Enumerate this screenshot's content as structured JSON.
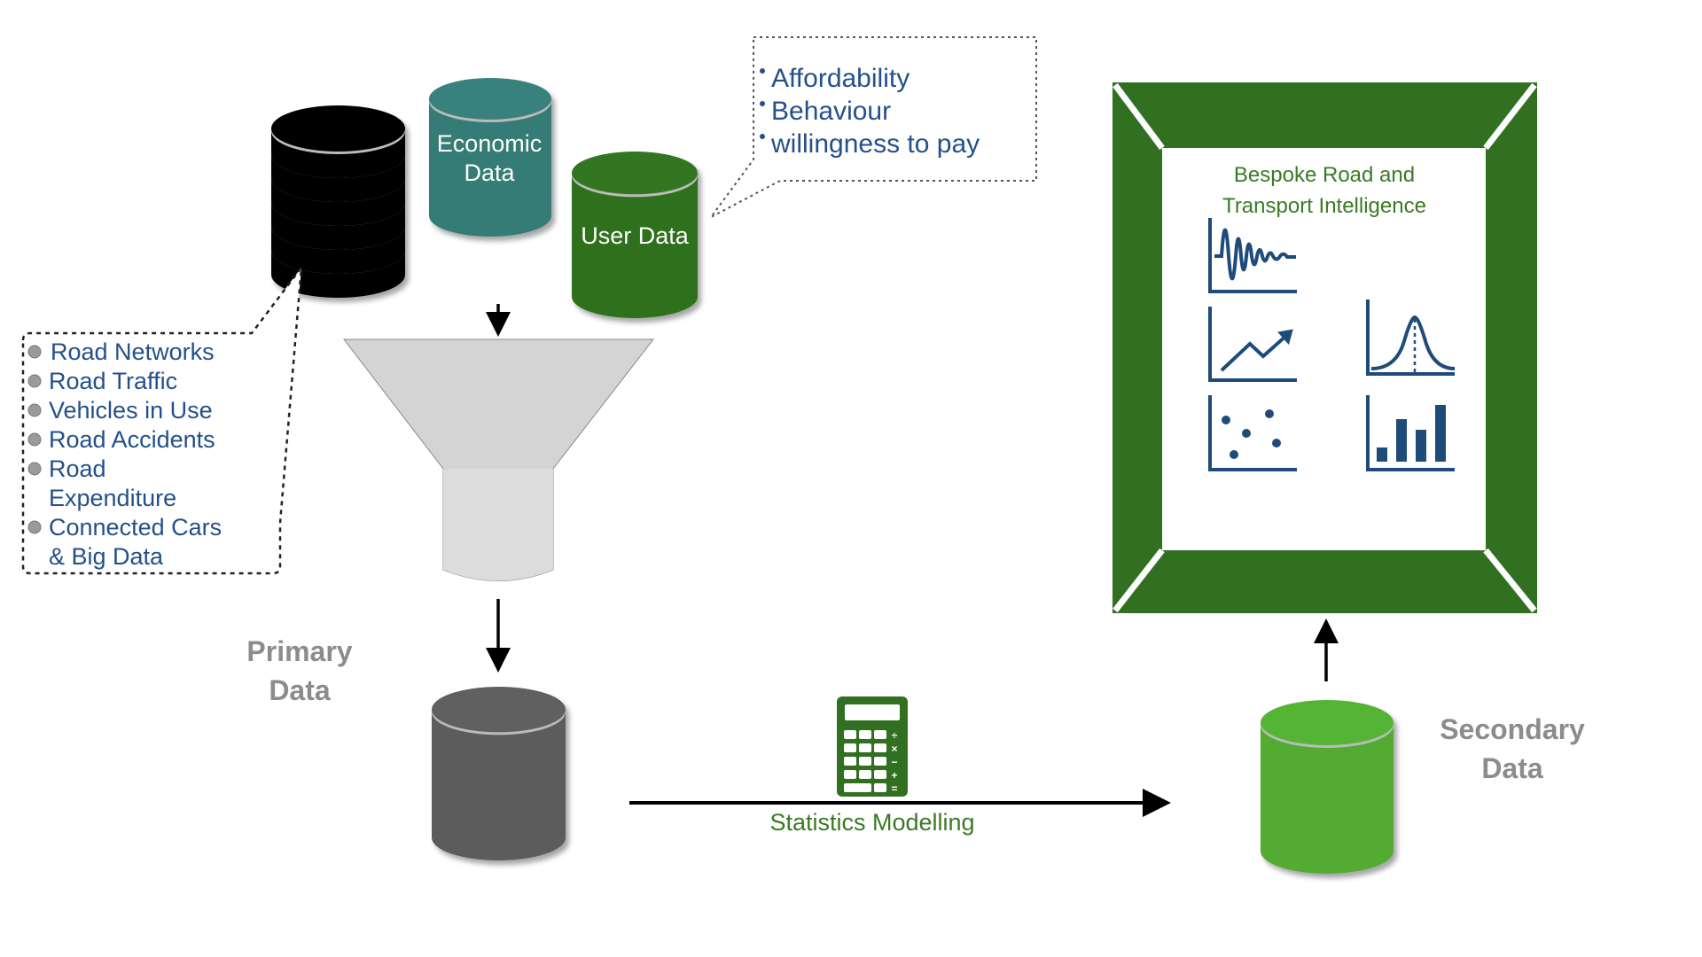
{
  "colors": {
    "text_blue": "#24508a",
    "frame_green": "#317021",
    "teal": "#367b76",
    "user_green": "#2f701f",
    "primary_gray": "#5c5c5c",
    "secondary_green": "#52ab33",
    "icon_blue": "#1f4b7a",
    "funnel_gray": "#d4d4d4"
  },
  "sources": {
    "economic_label": [
      "Economic",
      "Data"
    ],
    "user_label": "User Data"
  },
  "user_callout": [
    "Affordability",
    "Behaviour",
    "willingness to pay"
  ],
  "road_list": [
    {
      "lines": [
        "Road Networks"
      ]
    },
    {
      "lines": [
        "Road Traffic"
      ]
    },
    {
      "lines": [
        "Vehicles in Use"
      ]
    },
    {
      "lines": [
        "Road Accidents"
      ]
    },
    {
      "lines": [
        "Road",
        "Expenditure"
      ]
    },
    {
      "lines": [
        "Connected Cars",
        "& Big Data"
      ]
    }
  ],
  "primary_label": [
    "Primary",
    "Data"
  ],
  "secondary_label": [
    "Secondary",
    "Data"
  ],
  "process_label": "Statistics Modelling",
  "process_icon": "calculator-icon",
  "output": {
    "title": [
      "Bespoke Road and",
      "Transport Intelligence"
    ],
    "icons": [
      "waveform-chart-icon",
      "trend-line-chart-icon",
      "bell-curve-chart-icon",
      "scatter-chart-icon",
      "bar-chart-icon"
    ]
  }
}
